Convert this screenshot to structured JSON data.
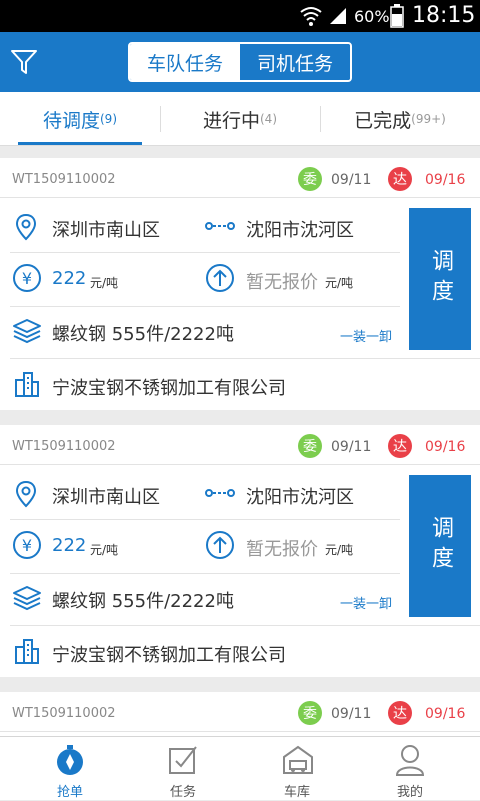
{
  "status_bar": {
    "battery_pct": "60%",
    "time": "18:15"
  },
  "header": {
    "segment": [
      "车队任务",
      "司机任务"
    ]
  },
  "tabs": [
    {
      "label": "待调度",
      "count": "(9)"
    },
    {
      "label": "进行中",
      "count": "(4)"
    },
    {
      "label": "已完成",
      "count": "(99+)"
    }
  ],
  "orders": [
    {
      "code": "WT1509110002",
      "commission_badge": "委",
      "commission_date": "09/11",
      "arrival_badge": "达",
      "arrival_date": "09/16",
      "origin": "深圳市南山区",
      "destination": "沈阳市沈河区",
      "price": "222",
      "price_unit": "元/吨",
      "quote": "暂无报价",
      "quote_unit": "元/吨",
      "cargo": "螺纹钢 555件/2222吨",
      "load_type": "一装一卸",
      "company": "宁波宝钢不锈钢加工有限公司",
      "dispatch_label": "调度"
    },
    {
      "code": "WT1509110002",
      "commission_badge": "委",
      "commission_date": "09/11",
      "arrival_badge": "达",
      "arrival_date": "09/16",
      "origin": "深圳市南山区",
      "destination": "沈阳市沈河区",
      "price": "222",
      "price_unit": "元/吨",
      "quote": "暂无报价",
      "quote_unit": "元/吨",
      "cargo": "螺纹钢 555件/2222吨",
      "load_type": "一装一卸",
      "company": "宁波宝钢不锈钢加工有限公司",
      "dispatch_label": "调度"
    },
    {
      "code": "WT1509110002",
      "commission_badge": "委",
      "commission_date": "09/11",
      "arrival_badge": "达",
      "arrival_date": "09/16"
    }
  ],
  "bottom_nav": [
    {
      "label": "抢单",
      "icon": "compass-icon",
      "active": true
    },
    {
      "label": "任务",
      "icon": "checklist-icon"
    },
    {
      "label": "车库",
      "icon": "garage-icon"
    },
    {
      "label": "我的",
      "icon": "user-icon"
    }
  ],
  "colors": {
    "primary": "#1a79c8",
    "green_badge": "#7ccd4e",
    "red_badge": "#e94048"
  }
}
